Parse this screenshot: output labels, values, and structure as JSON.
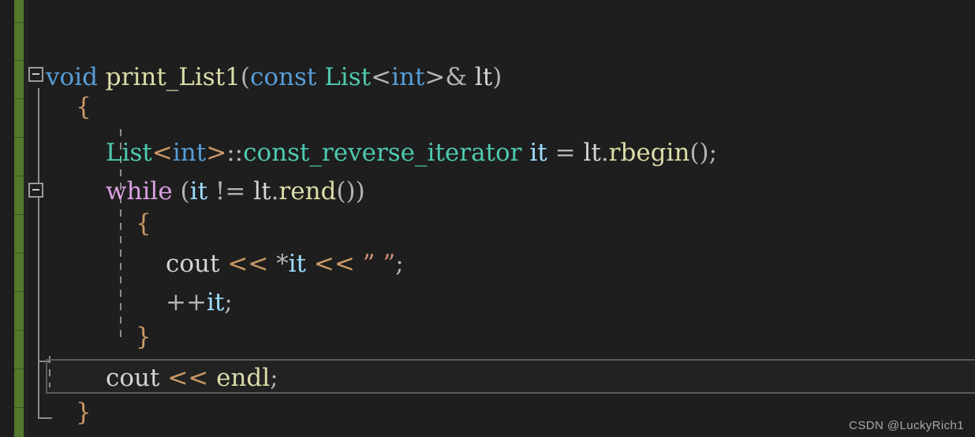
{
  "app": {
    "type": "code-editor",
    "language": "cpp",
    "theme": "dark",
    "background_color": "#1e1e1e",
    "change_bar_color": "#53792c",
    "highlight_border_color": "#5a5a5a"
  },
  "watermark": {
    "text": "CSDN @LuckyRich1"
  },
  "gutter": {
    "fold_markers": [
      {
        "name": "fold-function",
        "state": "expanded",
        "glyph": "−"
      },
      {
        "name": "fold-while",
        "state": "expanded",
        "glyph": "−"
      }
    ]
  },
  "code": {
    "lines": [
      {
        "id": 1,
        "indent": 0,
        "tokens": [
          {
            "text": "void",
            "kind": "keyword"
          },
          {
            "text": " ",
            "kind": "plain"
          },
          {
            "text": "print_List1",
            "kind": "function"
          },
          {
            "text": "(",
            "kind": "punct"
          },
          {
            "text": "const",
            "kind": "keyword"
          },
          {
            "text": " ",
            "kind": "plain"
          },
          {
            "text": "List",
            "kind": "type"
          },
          {
            "text": "<",
            "kind": "punct"
          },
          {
            "text": "int",
            "kind": "keyword"
          },
          {
            "text": ">",
            "kind": "punct"
          },
          {
            "text": "&",
            "kind": "punct"
          },
          {
            "text": " ",
            "kind": "plain"
          },
          {
            "text": "lt",
            "kind": "plain"
          },
          {
            "text": ")",
            "kind": "punct"
          }
        ]
      },
      {
        "id": 2,
        "indent": 1,
        "tokens": [
          {
            "text": "{",
            "kind": "brace"
          }
        ]
      },
      {
        "id": 3,
        "indent": 2,
        "tokens": [
          {
            "text": "List",
            "kind": "type"
          },
          {
            "text": "<",
            "kind": "brace"
          },
          {
            "text": "int",
            "kind": "keyword"
          },
          {
            "text": ">",
            "kind": "brace"
          },
          {
            "text": "::",
            "kind": "punct"
          },
          {
            "text": "const_reverse_iterator",
            "kind": "type"
          },
          {
            "text": " ",
            "kind": "plain"
          },
          {
            "text": "it",
            "kind": "variable"
          },
          {
            "text": " ",
            "kind": "plain"
          },
          {
            "text": "=",
            "kind": "punct"
          },
          {
            "text": " ",
            "kind": "plain"
          },
          {
            "text": "lt",
            "kind": "plain"
          },
          {
            "text": ".",
            "kind": "punct"
          },
          {
            "text": "rbegin",
            "kind": "function"
          },
          {
            "text": "();",
            "kind": "punct"
          }
        ]
      },
      {
        "id": 4,
        "indent": 2,
        "tokens": [
          {
            "text": "while",
            "kind": "control"
          },
          {
            "text": " ",
            "kind": "plain"
          },
          {
            "text": "(",
            "kind": "punct"
          },
          {
            "text": "it",
            "kind": "variable"
          },
          {
            "text": " ",
            "kind": "plain"
          },
          {
            "text": "!=",
            "kind": "punct"
          },
          {
            "text": " ",
            "kind": "plain"
          },
          {
            "text": "lt",
            "kind": "plain"
          },
          {
            "text": ".",
            "kind": "punct"
          },
          {
            "text": "rend",
            "kind": "function"
          },
          {
            "text": "())",
            "kind": "punct"
          }
        ]
      },
      {
        "id": 5,
        "indent": 3,
        "tokens": [
          {
            "text": "{",
            "kind": "brace"
          }
        ]
      },
      {
        "id": 6,
        "indent": 4,
        "tokens": [
          {
            "text": "cout",
            "kind": "plain"
          },
          {
            "text": " ",
            "kind": "plain"
          },
          {
            "text": "<<",
            "kind": "brace"
          },
          {
            "text": " ",
            "kind": "plain"
          },
          {
            "text": "*",
            "kind": "punct"
          },
          {
            "text": "it",
            "kind": "variable"
          },
          {
            "text": " ",
            "kind": "plain"
          },
          {
            "text": "<<",
            "kind": "brace"
          },
          {
            "text": " ",
            "kind": "plain"
          },
          {
            "text": "” ”",
            "kind": "string"
          },
          {
            "text": ";",
            "kind": "punct"
          }
        ]
      },
      {
        "id": 7,
        "indent": 4,
        "tokens": [
          {
            "text": "++",
            "kind": "punct"
          },
          {
            "text": "it",
            "kind": "variable"
          },
          {
            "text": ";",
            "kind": "punct"
          }
        ]
      },
      {
        "id": 8,
        "indent": 3,
        "tokens": [
          {
            "text": "}",
            "kind": "brace"
          }
        ]
      },
      {
        "id": 9,
        "indent": 2,
        "highlighted": true,
        "tokens": [
          {
            "text": "cout",
            "kind": "plain"
          },
          {
            "text": " ",
            "kind": "plain"
          },
          {
            "text": "<<",
            "kind": "brace"
          },
          {
            "text": " ",
            "kind": "plain"
          },
          {
            "text": "endl",
            "kind": "function"
          },
          {
            "text": ";",
            "kind": "punct"
          }
        ]
      },
      {
        "id": 10,
        "indent": 1,
        "tokens": [
          {
            "text": "}",
            "kind": "brace"
          }
        ]
      }
    ]
  }
}
